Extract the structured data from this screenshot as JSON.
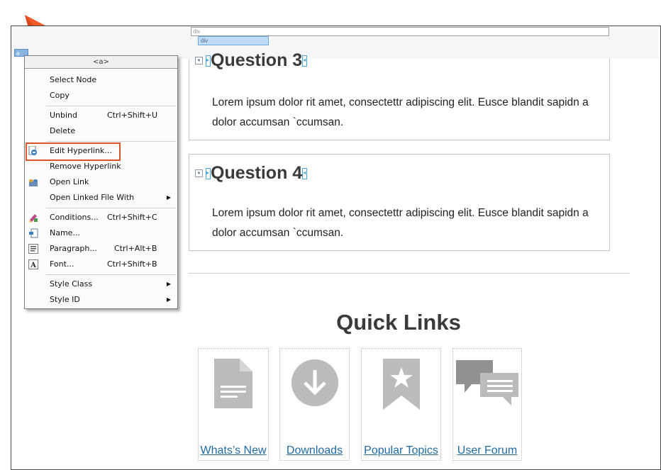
{
  "breadcrumb": {
    "div_outer": "div",
    "div_inner": "div",
    "node": "a"
  },
  "questions": [
    {
      "title": "Question 3",
      "body": "Lorem ipsum dolor rit amet, consectettr adipiscing elit. Eusce blandit sapidn a dolor accumsan `ccumsan."
    },
    {
      "title": "Question 4",
      "body": "Lorem ipsum dolor rit amet, consectettr adipiscing elit. Eusce blandit sapidn a dolor accumsan `ccumsan."
    }
  ],
  "quick_links": {
    "title": "Quick Links",
    "items": [
      {
        "label": "Whats’s New",
        "icon": "document-icon"
      },
      {
        "label": "Downloads",
        "icon": "download-icon"
      },
      {
        "label": "Popular Topics",
        "icon": "bookmark-star-icon"
      },
      {
        "label": "User Forum",
        "icon": "chat-bubbles-icon"
      }
    ]
  },
  "context_menu": {
    "header": "<a>",
    "items": {
      "select_node": {
        "label": "Select Node"
      },
      "copy": {
        "label": "Copy"
      },
      "unbind": {
        "label": "Unbind",
        "shortcut": "Ctrl+Shift+U"
      },
      "delete": {
        "label": "Delete"
      },
      "edit_hyperlink": {
        "label": "Edit Hyperlink...",
        "icon": "edit-hyperlink-icon"
      },
      "remove_hyperlink": {
        "label": "Remove Hyperlink"
      },
      "open_link": {
        "label": "Open Link",
        "icon": "open-link-icon"
      },
      "open_linked_file_with": {
        "label": "Open Linked File With"
      },
      "conditions": {
        "label": "Conditions...",
        "shortcut": "Ctrl+Shift+C",
        "icon": "conditions-icon"
      },
      "name": {
        "label": "Name...",
        "icon": "name-icon"
      },
      "paragraph": {
        "label": "Paragraph...",
        "shortcut": "Ctrl+Alt+B",
        "icon": "paragraph-icon"
      },
      "font": {
        "label": "Font...",
        "shortcut": "Ctrl+Shift+B",
        "icon": "font-icon"
      },
      "style_class": {
        "label": "Style Class"
      },
      "style_id": {
        "label": "Style ID"
      }
    }
  },
  "colors": {
    "highlight": "#d9532b",
    "link": "#1f6aa5",
    "pointer": "#f05a28",
    "icon_gray": "#b9bbbd"
  }
}
